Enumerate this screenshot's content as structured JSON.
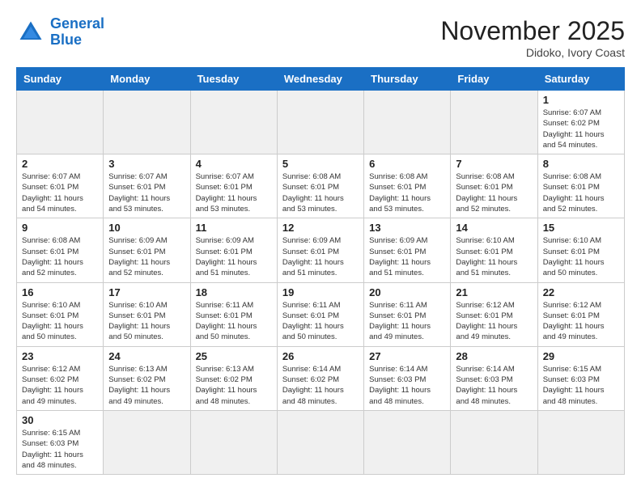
{
  "header": {
    "logo_general": "General",
    "logo_blue": "Blue",
    "month_title": "November 2025",
    "location": "Didoko, Ivory Coast"
  },
  "days_of_week": [
    "Sunday",
    "Monday",
    "Tuesday",
    "Wednesday",
    "Thursday",
    "Friday",
    "Saturday"
  ],
  "weeks": [
    [
      {
        "day": "",
        "info": ""
      },
      {
        "day": "",
        "info": ""
      },
      {
        "day": "",
        "info": ""
      },
      {
        "day": "",
        "info": ""
      },
      {
        "day": "",
        "info": ""
      },
      {
        "day": "",
        "info": ""
      },
      {
        "day": "1",
        "info": "Sunrise: 6:07 AM\nSunset: 6:02 PM\nDaylight: 11 hours\nand 54 minutes."
      }
    ],
    [
      {
        "day": "2",
        "info": "Sunrise: 6:07 AM\nSunset: 6:01 PM\nDaylight: 11 hours\nand 54 minutes."
      },
      {
        "day": "3",
        "info": "Sunrise: 6:07 AM\nSunset: 6:01 PM\nDaylight: 11 hours\nand 53 minutes."
      },
      {
        "day": "4",
        "info": "Sunrise: 6:07 AM\nSunset: 6:01 PM\nDaylight: 11 hours\nand 53 minutes."
      },
      {
        "day": "5",
        "info": "Sunrise: 6:08 AM\nSunset: 6:01 PM\nDaylight: 11 hours\nand 53 minutes."
      },
      {
        "day": "6",
        "info": "Sunrise: 6:08 AM\nSunset: 6:01 PM\nDaylight: 11 hours\nand 53 minutes."
      },
      {
        "day": "7",
        "info": "Sunrise: 6:08 AM\nSunset: 6:01 PM\nDaylight: 11 hours\nand 52 minutes."
      },
      {
        "day": "8",
        "info": "Sunrise: 6:08 AM\nSunset: 6:01 PM\nDaylight: 11 hours\nand 52 minutes."
      }
    ],
    [
      {
        "day": "9",
        "info": "Sunrise: 6:08 AM\nSunset: 6:01 PM\nDaylight: 11 hours\nand 52 minutes."
      },
      {
        "day": "10",
        "info": "Sunrise: 6:09 AM\nSunset: 6:01 PM\nDaylight: 11 hours\nand 52 minutes."
      },
      {
        "day": "11",
        "info": "Sunrise: 6:09 AM\nSunset: 6:01 PM\nDaylight: 11 hours\nand 51 minutes."
      },
      {
        "day": "12",
        "info": "Sunrise: 6:09 AM\nSunset: 6:01 PM\nDaylight: 11 hours\nand 51 minutes."
      },
      {
        "day": "13",
        "info": "Sunrise: 6:09 AM\nSunset: 6:01 PM\nDaylight: 11 hours\nand 51 minutes."
      },
      {
        "day": "14",
        "info": "Sunrise: 6:10 AM\nSunset: 6:01 PM\nDaylight: 11 hours\nand 51 minutes."
      },
      {
        "day": "15",
        "info": "Sunrise: 6:10 AM\nSunset: 6:01 PM\nDaylight: 11 hours\nand 50 minutes."
      }
    ],
    [
      {
        "day": "16",
        "info": "Sunrise: 6:10 AM\nSunset: 6:01 PM\nDaylight: 11 hours\nand 50 minutes."
      },
      {
        "day": "17",
        "info": "Sunrise: 6:10 AM\nSunset: 6:01 PM\nDaylight: 11 hours\nand 50 minutes."
      },
      {
        "day": "18",
        "info": "Sunrise: 6:11 AM\nSunset: 6:01 PM\nDaylight: 11 hours\nand 50 minutes."
      },
      {
        "day": "19",
        "info": "Sunrise: 6:11 AM\nSunset: 6:01 PM\nDaylight: 11 hours\nand 50 minutes."
      },
      {
        "day": "20",
        "info": "Sunrise: 6:11 AM\nSunset: 6:01 PM\nDaylight: 11 hours\nand 49 minutes."
      },
      {
        "day": "21",
        "info": "Sunrise: 6:12 AM\nSunset: 6:01 PM\nDaylight: 11 hours\nand 49 minutes."
      },
      {
        "day": "22",
        "info": "Sunrise: 6:12 AM\nSunset: 6:01 PM\nDaylight: 11 hours\nand 49 minutes."
      }
    ],
    [
      {
        "day": "23",
        "info": "Sunrise: 6:12 AM\nSunset: 6:02 PM\nDaylight: 11 hours\nand 49 minutes."
      },
      {
        "day": "24",
        "info": "Sunrise: 6:13 AM\nSunset: 6:02 PM\nDaylight: 11 hours\nand 49 minutes."
      },
      {
        "day": "25",
        "info": "Sunrise: 6:13 AM\nSunset: 6:02 PM\nDaylight: 11 hours\nand 48 minutes."
      },
      {
        "day": "26",
        "info": "Sunrise: 6:14 AM\nSunset: 6:02 PM\nDaylight: 11 hours\nand 48 minutes."
      },
      {
        "day": "27",
        "info": "Sunrise: 6:14 AM\nSunset: 6:03 PM\nDaylight: 11 hours\nand 48 minutes."
      },
      {
        "day": "28",
        "info": "Sunrise: 6:14 AM\nSunset: 6:03 PM\nDaylight: 11 hours\nand 48 minutes."
      },
      {
        "day": "29",
        "info": "Sunrise: 6:15 AM\nSunset: 6:03 PM\nDaylight: 11 hours\nand 48 minutes."
      }
    ],
    [
      {
        "day": "30",
        "info": "Sunrise: 6:15 AM\nSunset: 6:03 PM\nDaylight: 11 hours\nand 48 minutes."
      },
      {
        "day": "",
        "info": ""
      },
      {
        "day": "",
        "info": ""
      },
      {
        "day": "",
        "info": ""
      },
      {
        "day": "",
        "info": ""
      },
      {
        "day": "",
        "info": ""
      },
      {
        "day": "",
        "info": ""
      }
    ]
  ]
}
